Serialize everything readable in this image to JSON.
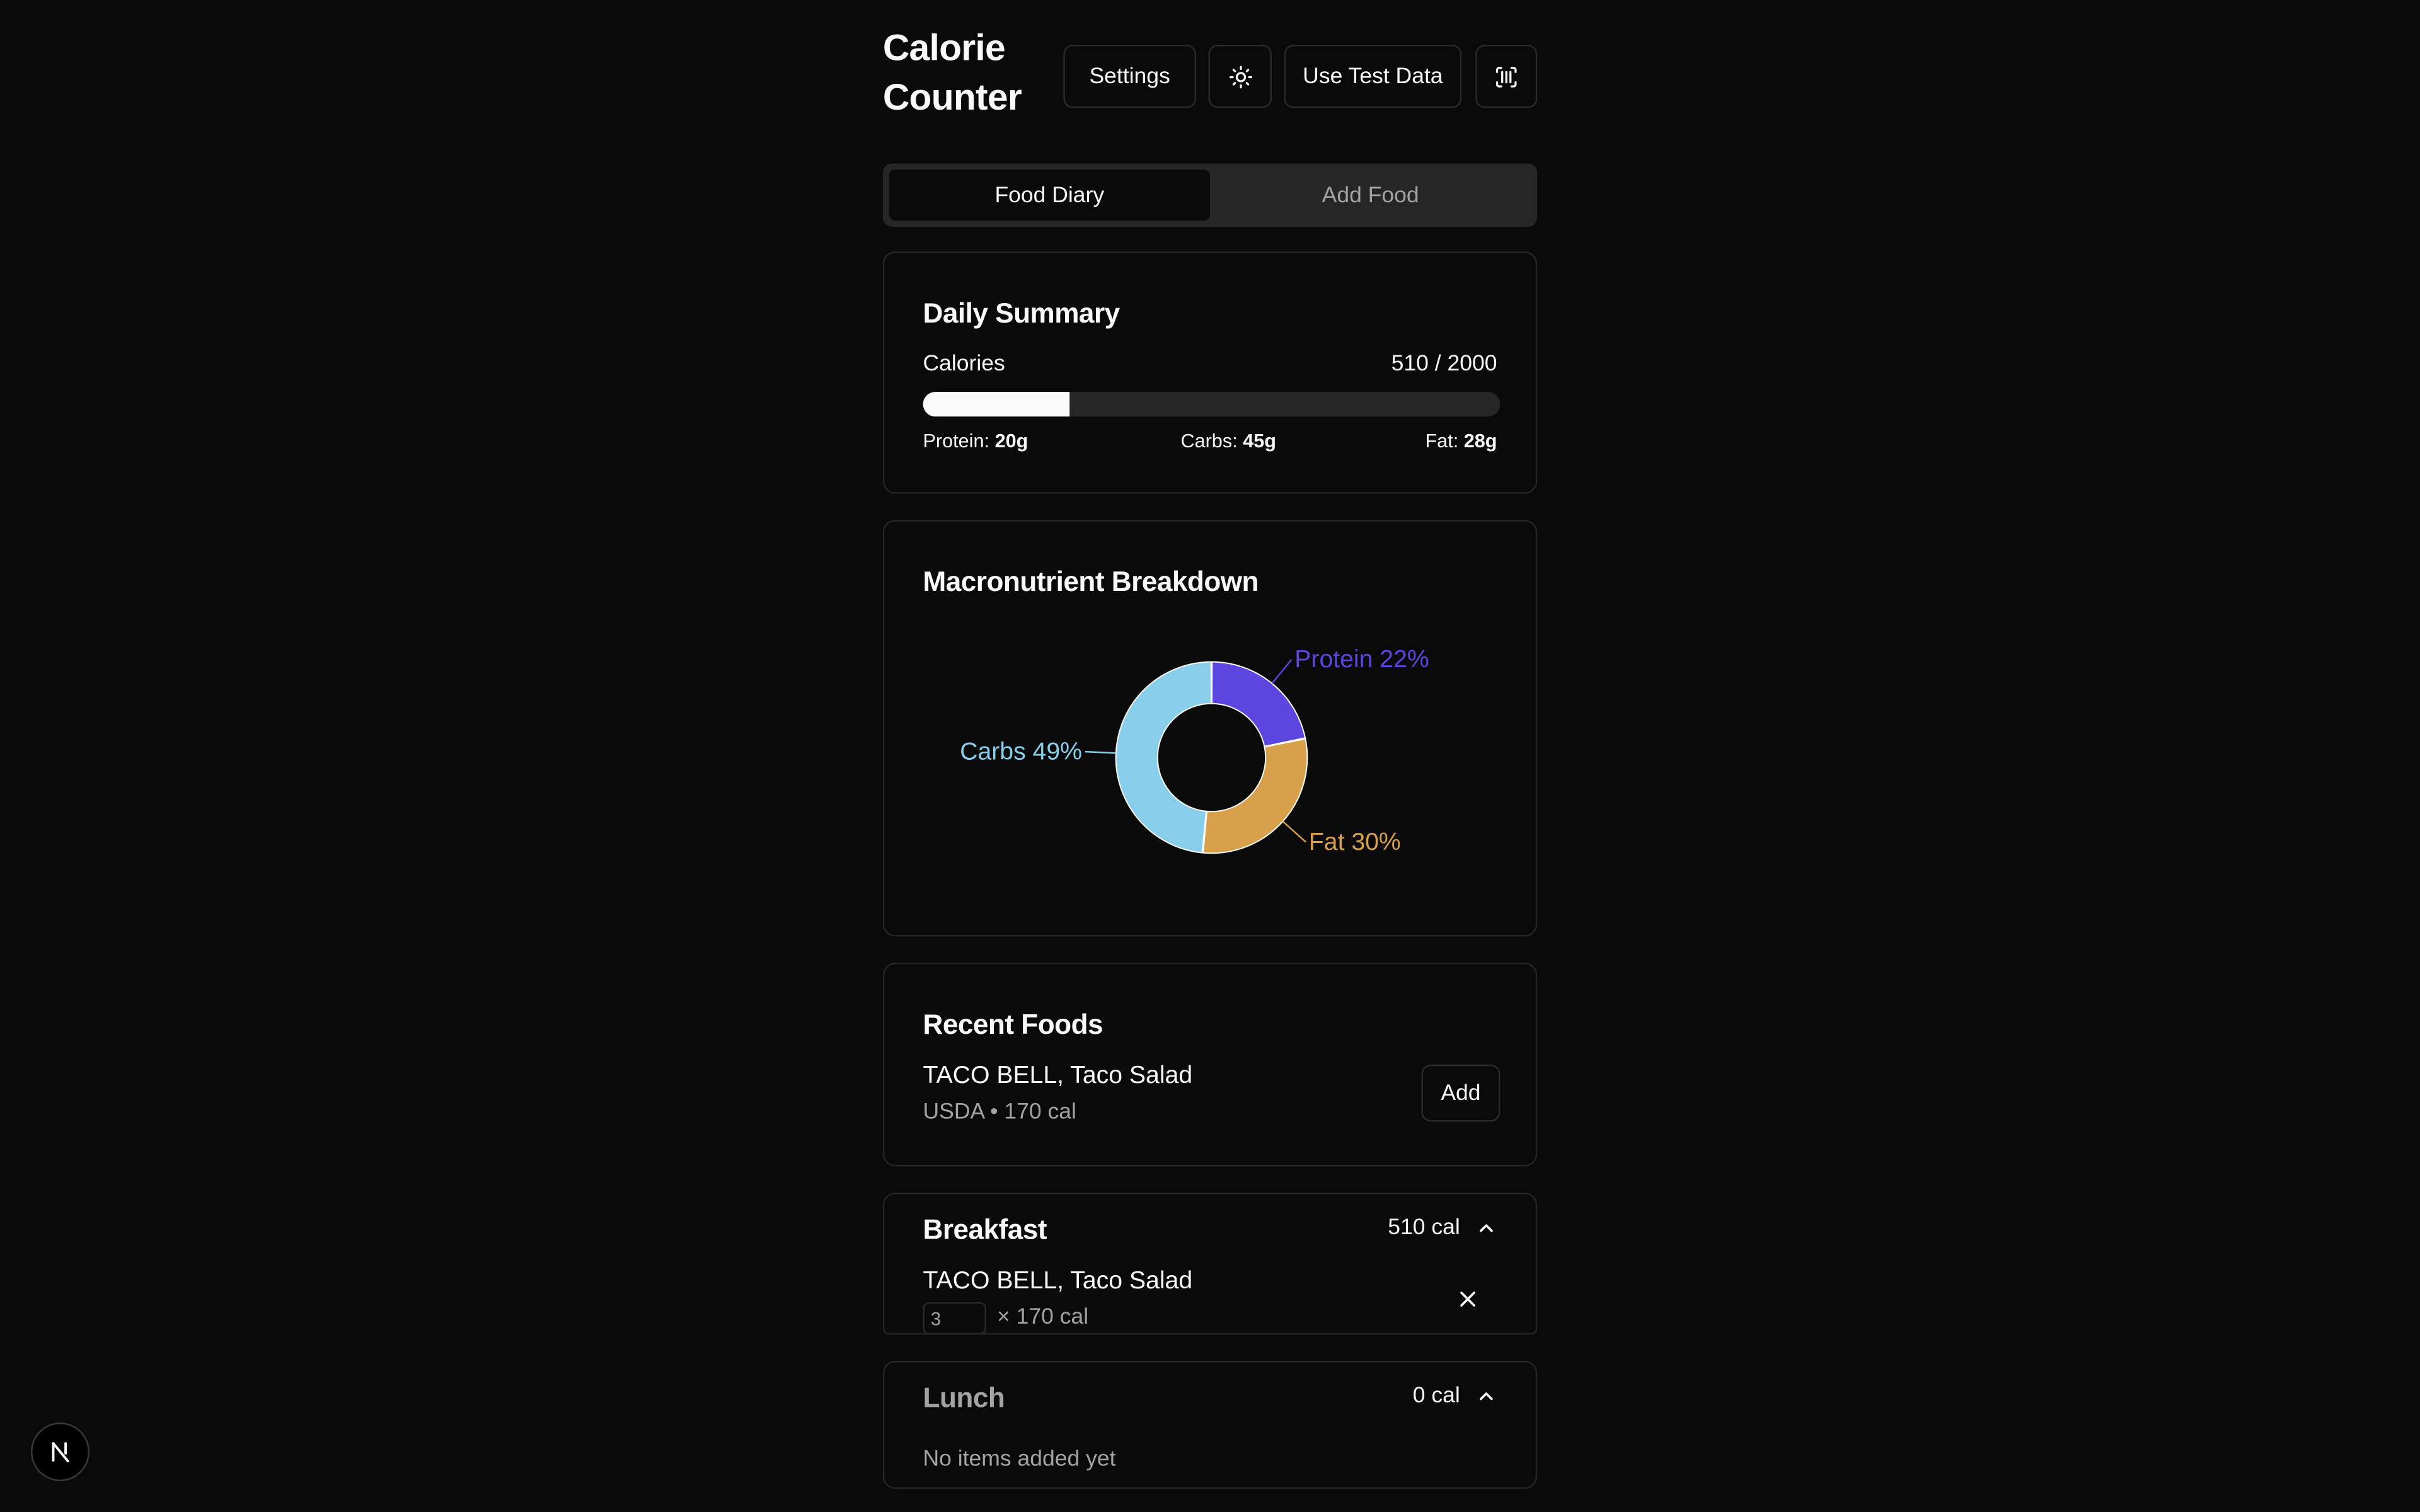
{
  "app": {
    "title_line1": "Calorie",
    "title_line2": "Counter"
  },
  "toolbar": {
    "settings_label": "Settings",
    "theme_icon": "sun-icon",
    "test_data_label": "Use Test Data",
    "scan_icon": "barcode-scan-icon"
  },
  "tabs": [
    {
      "label": "Food Diary",
      "active": true
    },
    {
      "label": "Add Food",
      "active": false
    }
  ],
  "daily_summary": {
    "title": "Daily Summary",
    "calories_label": "Calories",
    "calories_value": "510 / 2000",
    "calories_consumed": 510,
    "calories_goal": 2000,
    "protein_label": "Protein:",
    "protein_value": "20g",
    "carbs_label": "Carbs:",
    "carbs_value": "45g",
    "fat_label": "Fat:",
    "fat_value": "28g"
  },
  "macro_breakdown": {
    "title": "Macronutrient Breakdown"
  },
  "chart_data": {
    "type": "pie",
    "donut": true,
    "categories": [
      "Protein",
      "Fat",
      "Carbs"
    ],
    "values": [
      22,
      30,
      49
    ],
    "labels": [
      "Protein 22%",
      "Fat 30%",
      "Carbs 49%"
    ],
    "colors": [
      "#5b47e0",
      "#d9a04c",
      "#87ceeb"
    ]
  },
  "recent_foods": {
    "title": "Recent Foods",
    "items": [
      {
        "name": "TACO BELL, Taco Salad",
        "meta": "USDA • 170 cal",
        "add_label": "Add"
      }
    ]
  },
  "meals": [
    {
      "name": "Breakfast",
      "total": "510 cal",
      "items": [
        {
          "name": "TACO BELL, Taco Salad",
          "quantity": "3",
          "per_unit": "× 170 cal"
        }
      ]
    },
    {
      "name": "Lunch",
      "total": "0 cal",
      "empty_text": "No items added yet"
    }
  ],
  "colors": {
    "background": "#0a0a0a",
    "border": "#262626",
    "text": "#fafafa",
    "muted": "#a3a3a3"
  }
}
